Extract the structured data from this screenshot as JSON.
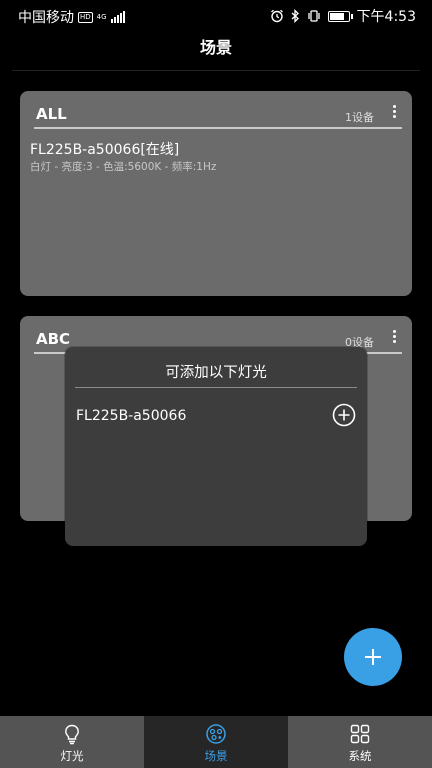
{
  "status_bar": {
    "carrier": "中国移动",
    "hd": "HD",
    "network": "4G",
    "time": "下午4:53",
    "battery_level": 0.7
  },
  "header": {
    "title": "场景"
  },
  "scenes": [
    {
      "name": "ALL",
      "device_count": "1设备",
      "lights": [
        {
          "name": "FL225B-a50066[在线]",
          "detail": "白灯 - 亮度:3 - 色温:5600K - 频率:1Hz"
        }
      ]
    },
    {
      "name": "ABC",
      "device_count": "0设备",
      "lights": []
    }
  ],
  "popup": {
    "title": "可添加以下灯光",
    "items": [
      {
        "name": "FL225B-a50066"
      }
    ]
  },
  "fab": {
    "icon": "plus-icon"
  },
  "bottom_nav": {
    "items": [
      {
        "label": "灯光",
        "icon": "bulb-icon"
      },
      {
        "label": "场景",
        "icon": "scene-icon"
      },
      {
        "label": "系统",
        "icon": "grid-icon"
      }
    ],
    "active_index": 1
  },
  "colors": {
    "accent": "#3aa0e6",
    "card_bg": "#6b6b6b",
    "popup_bg": "#3d3d3d",
    "nav_bg": "#545454",
    "nav_active_bg": "#262626"
  }
}
